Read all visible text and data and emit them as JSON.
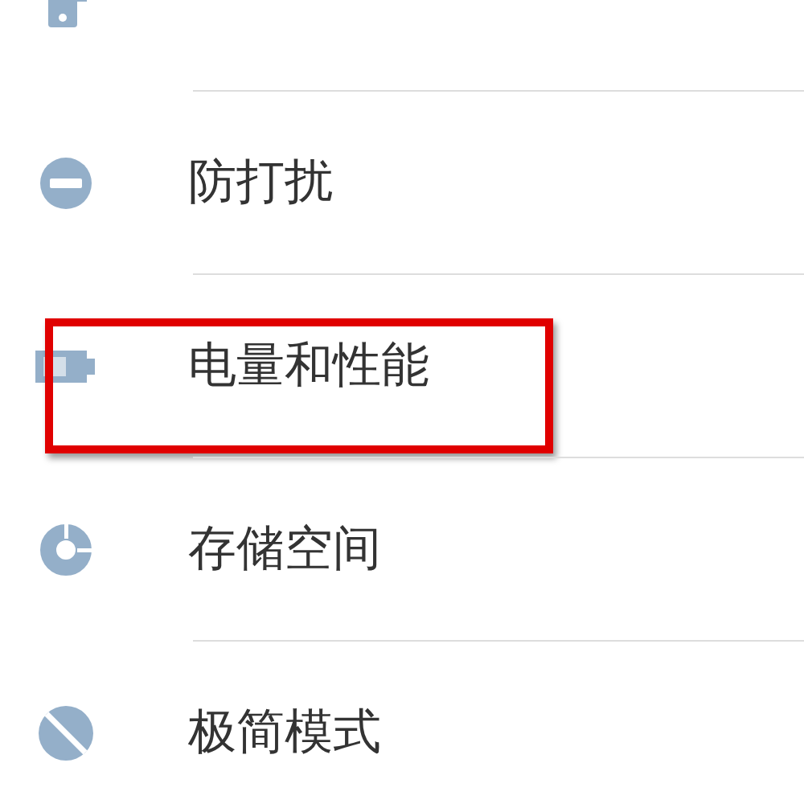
{
  "settings_items": [
    {
      "highlighted": false
    },
    {
      "label": "防打扰",
      "highlighted": false
    },
    {
      "label": "电量和性能",
      "highlighted": true
    },
    {
      "label": "存储空间",
      "highlighted": false
    },
    {
      "label": "极简模式",
      "highlighted": false
    }
  ]
}
